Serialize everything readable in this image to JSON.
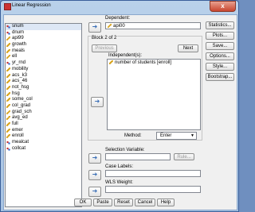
{
  "window": {
    "title": "Linear Regression",
    "close_label": "x"
  },
  "variables": [
    {
      "name": "snum",
      "icon": "nominal-icon"
    },
    {
      "name": "dnum",
      "icon": "nominal-icon"
    },
    {
      "name": "api99",
      "icon": "scale-icon"
    },
    {
      "name": "growth",
      "icon": "scale-icon"
    },
    {
      "name": "meals",
      "icon": "scale-icon"
    },
    {
      "name": "ell",
      "icon": "scale-icon"
    },
    {
      "name": "yr_rnd",
      "icon": "nominal-icon"
    },
    {
      "name": "mobility",
      "icon": "scale-icon"
    },
    {
      "name": "acs_k3",
      "icon": "scale-icon"
    },
    {
      "name": "acs_46",
      "icon": "scale-icon"
    },
    {
      "name": "not_hsg",
      "icon": "scale-icon"
    },
    {
      "name": "hsg",
      "icon": "scale-icon"
    },
    {
      "name": "some_col",
      "icon": "scale-icon"
    },
    {
      "name": "col_grad",
      "icon": "scale-icon"
    },
    {
      "name": "grad_sch",
      "icon": "scale-icon"
    },
    {
      "name": "avg_ed",
      "icon": "scale-icon"
    },
    {
      "name": "full",
      "icon": "scale-icon"
    },
    {
      "name": "emer",
      "icon": "scale-icon"
    },
    {
      "name": "enroll",
      "icon": "scale-icon"
    },
    {
      "name": "mealcat",
      "icon": "nominal-icon"
    },
    {
      "name": "collcat",
      "icon": "nominal-icon"
    }
  ],
  "dependent": {
    "label": "Dependent:",
    "value": "api00"
  },
  "block": {
    "title": "Block 2 of 2",
    "previous": "Previous",
    "next": "Next",
    "independent_label": "Independent(s):",
    "independents": [
      "number of students [enroll]"
    ],
    "method_label": "Method:",
    "method_value": "Enter"
  },
  "selection": {
    "label": "Selection Variable:",
    "rule": "Rule..."
  },
  "case_labels": {
    "label": "Case Labels:"
  },
  "wls": {
    "label": "WLS Weight:"
  },
  "side_buttons": [
    "Statistics...",
    "Plots...",
    "Save...",
    "Options...",
    "Style...",
    "Bootstrap..."
  ],
  "bottom_buttons": [
    "OK",
    "Paste",
    "Reset",
    "Cancel",
    "Help"
  ],
  "arrow_glyph": "➜"
}
